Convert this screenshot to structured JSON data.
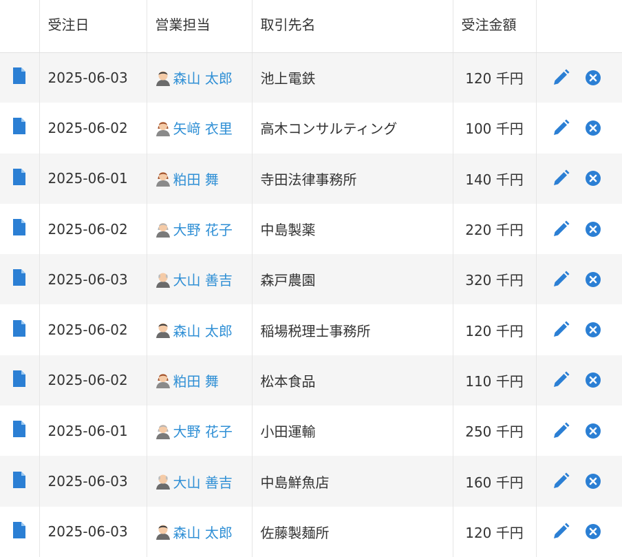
{
  "table": {
    "headers": {
      "order_date": "受注日",
      "sales_rep": "営業担当",
      "client": "取引先名",
      "amount": "受注金額"
    },
    "rows": [
      {
        "date": "2025-06-03",
        "rep": "森山 太郎",
        "avatar": "man-avatar-icon",
        "client": "池上電鉄",
        "amount": "120 千円"
      },
      {
        "date": "2025-06-02",
        "rep": "矢﨑 衣里",
        "avatar": "woman-avatar-icon",
        "client": "高木コンサルティング",
        "amount": "100 千円"
      },
      {
        "date": "2025-06-01",
        "rep": "粕田 舞",
        "avatar": "woman-avatar-icon",
        "client": "寺田法律事務所",
        "amount": "140 千円"
      },
      {
        "date": "2025-06-02",
        "rep": "大野 花子",
        "avatar": "old-woman-avatar-icon",
        "client": "中島製薬",
        "amount": "220 千円"
      },
      {
        "date": "2025-06-03",
        "rep": "大山 善吉",
        "avatar": "old-man-avatar-icon",
        "client": "森戸農園",
        "amount": "320 千円"
      },
      {
        "date": "2025-06-02",
        "rep": "森山 太郎",
        "avatar": "man-avatar-icon",
        "client": "稲場税理士事務所",
        "amount": "120 千円"
      },
      {
        "date": "2025-06-02",
        "rep": "粕田 舞",
        "avatar": "woman-avatar-icon",
        "client": "松本食品",
        "amount": "110 千円"
      },
      {
        "date": "2025-06-01",
        "rep": "大野 花子",
        "avatar": "old-woman-avatar-icon",
        "client": "小田運輸",
        "amount": "250 千円"
      },
      {
        "date": "2025-06-03",
        "rep": "大山 善吉",
        "avatar": "old-man-avatar-icon",
        "client": "中島鮮魚店",
        "amount": "160 千円"
      },
      {
        "date": "2025-06-03",
        "rep": "森山 太郎",
        "avatar": "man-avatar-icon",
        "client": "佐藤製麺所",
        "amount": "120 千円"
      }
    ]
  },
  "icons": {
    "document": "document-icon",
    "edit": "pencil-icon",
    "delete": "close-circle-icon"
  },
  "colors": {
    "accent": "#2f8fd5",
    "icon_blue": "#2b7fd4",
    "stripe": "#f5f5f5"
  }
}
